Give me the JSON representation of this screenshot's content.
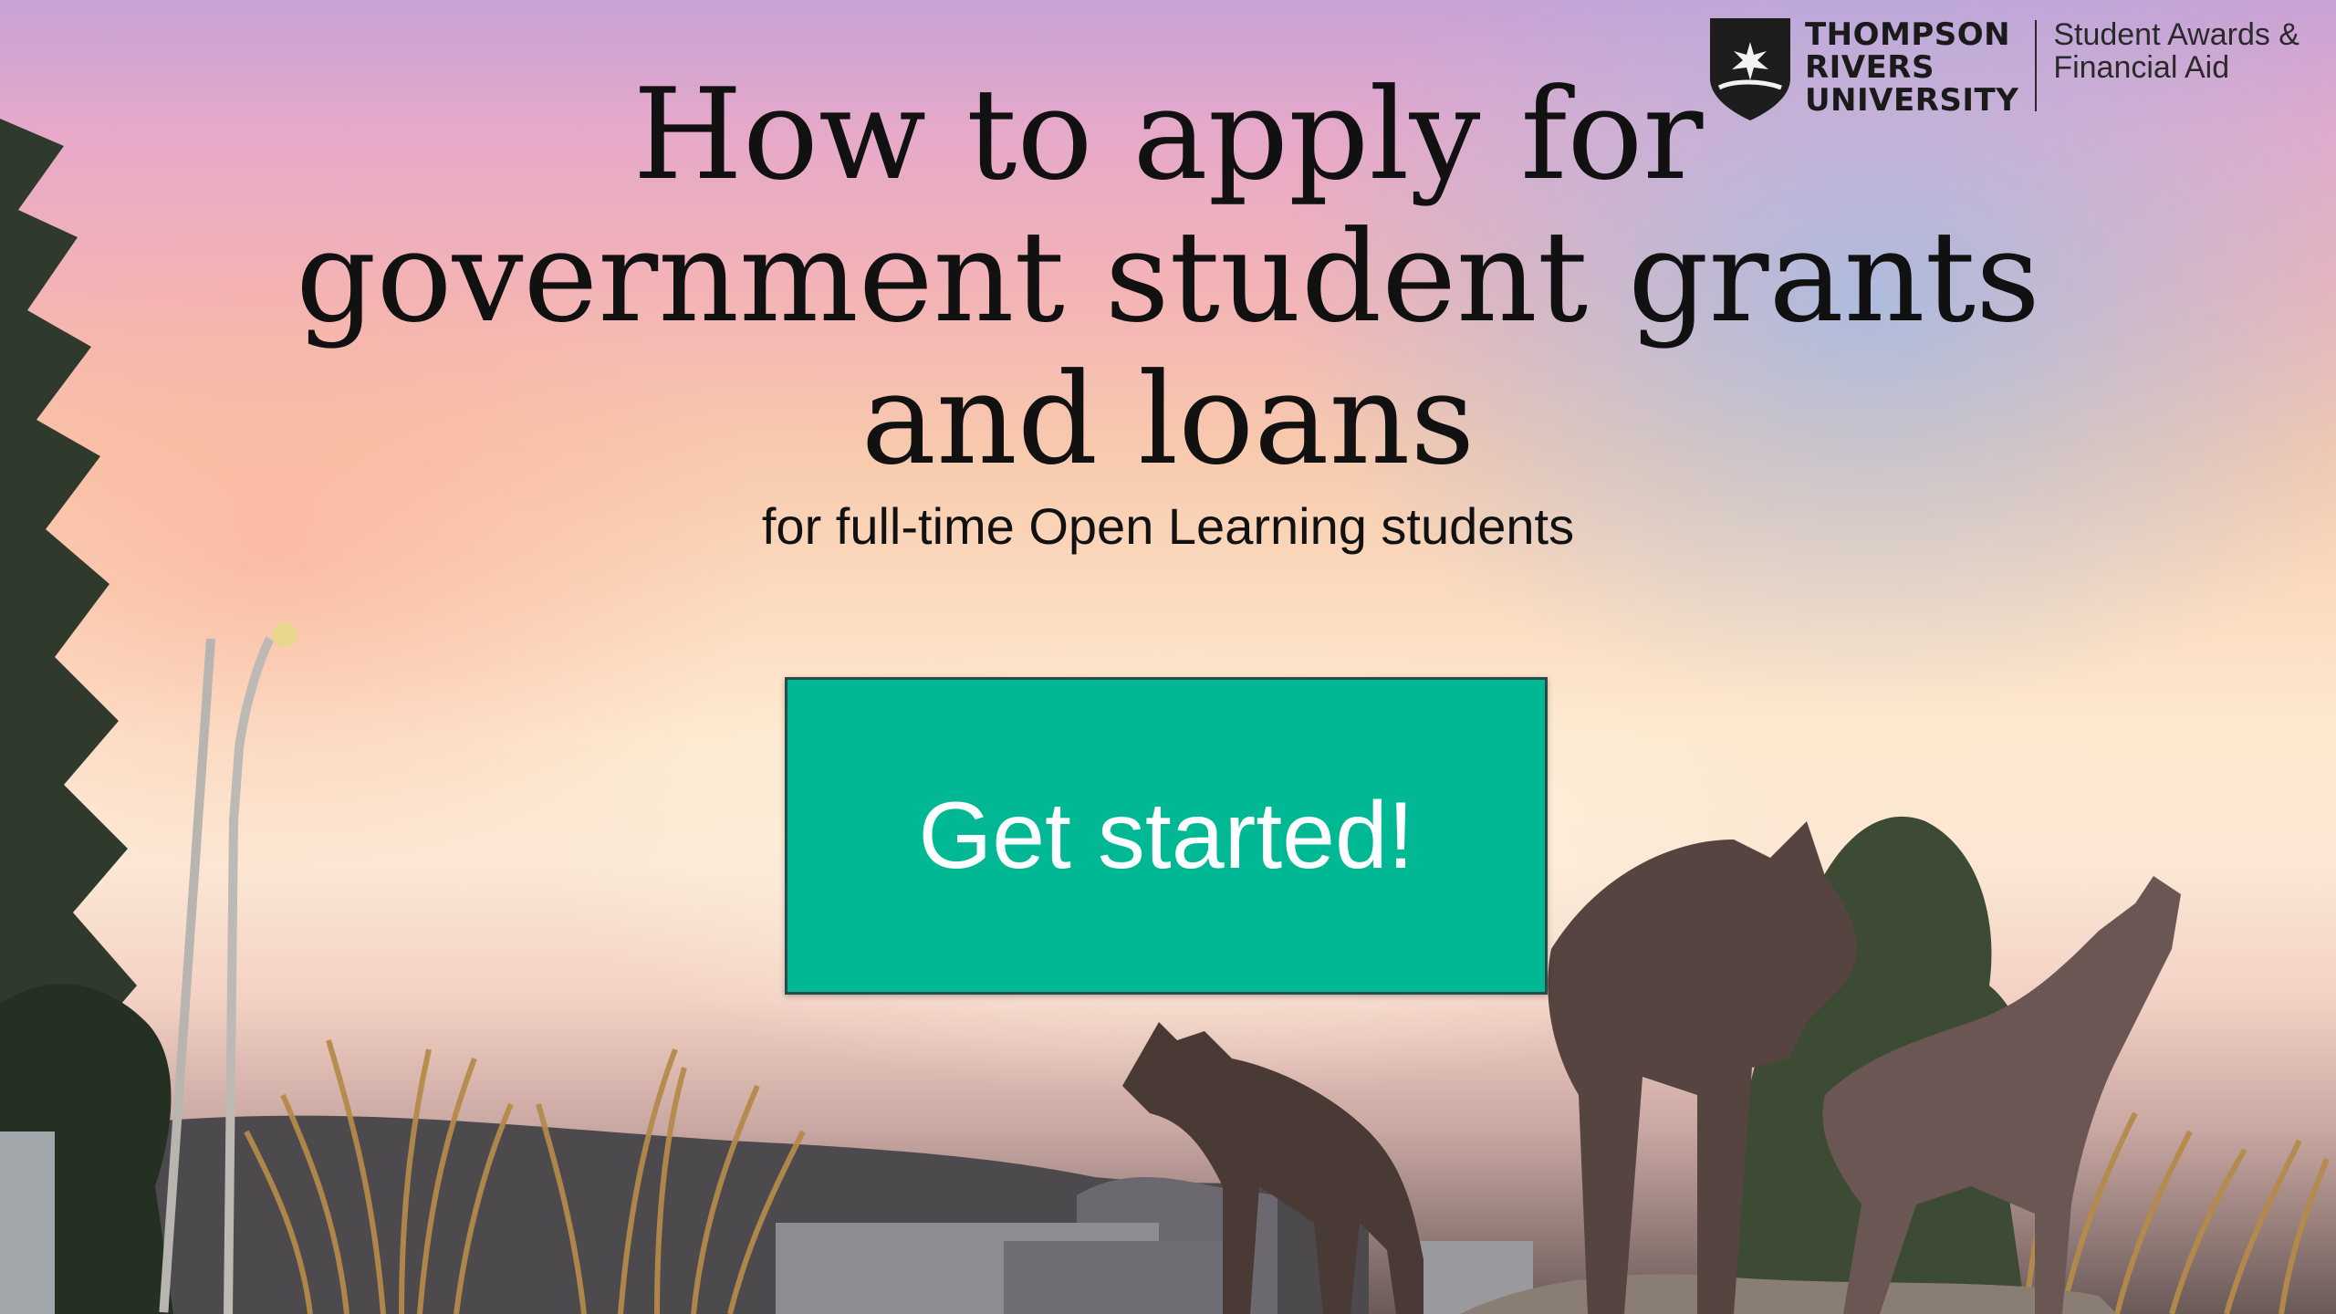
{
  "branding": {
    "university_lines": [
      "THOMPSON",
      "RIVERS",
      "UNIVERSITY"
    ],
    "department_lines": [
      "Student Awards &",
      "Financial Aid"
    ]
  },
  "hero": {
    "headline_lines": [
      "How to apply for",
      "government student grants",
      "and loans"
    ],
    "subtitle": "for full-time Open Learning students",
    "cta_label": "Get started!"
  },
  "colors": {
    "cta_background": "#00b894",
    "cta_text": "#ffffff",
    "headline_text": "#111111"
  },
  "icons": {
    "logo": "tru-logo-icon"
  }
}
